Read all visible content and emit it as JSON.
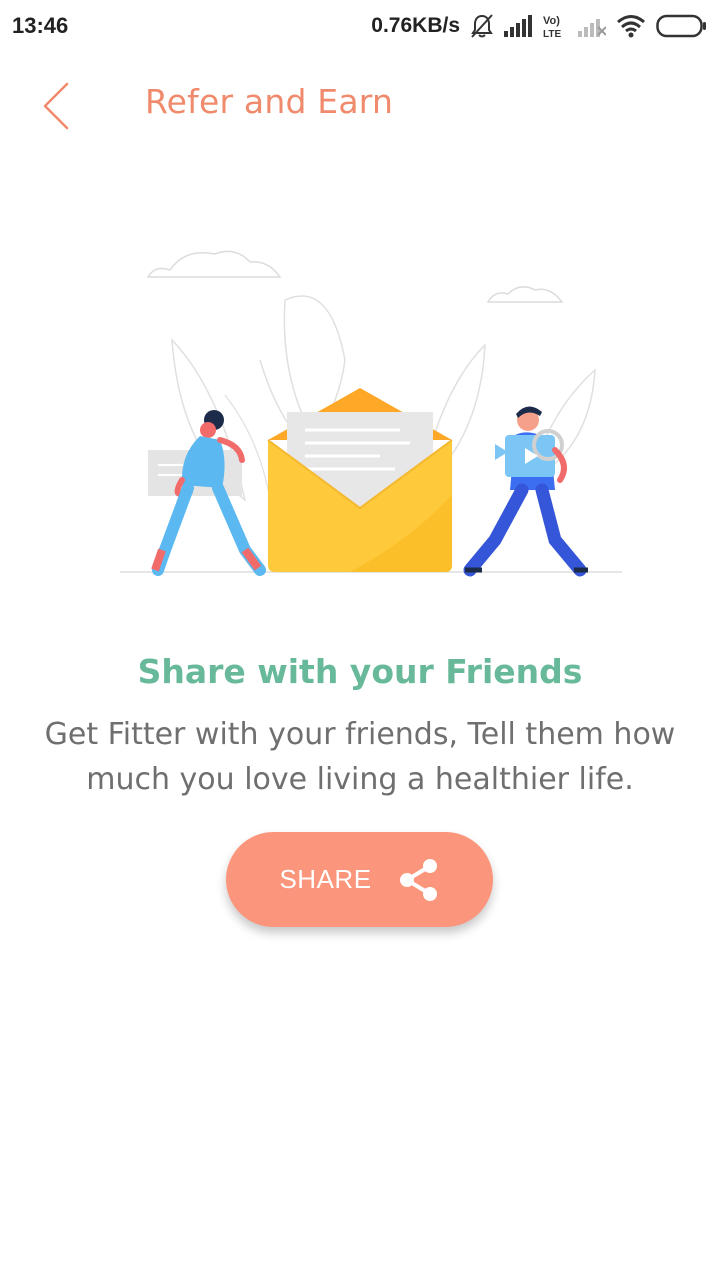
{
  "status_bar": {
    "time": "13:46",
    "net_speed": "0.76KB/s",
    "icons": [
      "bell-off-icon",
      "signal-icon",
      "volte-icon",
      "signal-weak-icon",
      "wifi-icon",
      "battery-icon"
    ]
  },
  "header": {
    "title": "Refer and Earn",
    "back_icon": "chevron-left-icon"
  },
  "main": {
    "headline": "Share with your Friends",
    "description": "Get Fitter with your friends, Tell them how much you love living a healthier life.",
    "share_button": {
      "label": "SHARE",
      "icon": "share-icon"
    }
  },
  "colors": {
    "accent": "#F08A6C",
    "button": "#FB957B",
    "headline": "#67B99A",
    "body_text": "#6f6f6f"
  }
}
